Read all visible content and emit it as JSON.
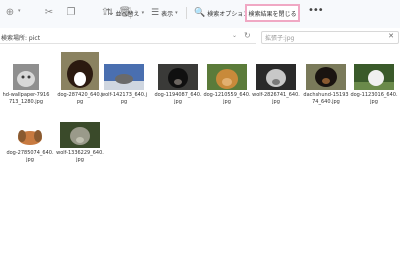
{
  "toolbar": {
    "sort_label": "並べ替え",
    "view_label": "表示",
    "search_options_label": "検索オプション",
    "close_search_label": "検索結果を閉じる",
    "more_label": "•••"
  },
  "address_bar": {
    "text": "検索場所: pict"
  },
  "search_box": {
    "placeholder": "拡張子:jpg"
  },
  "files": [
    {
      "name": "hd-wallpaper-7916713_1280.jpg",
      "thumb_colors": [
        "#8f8f8f",
        "#d8d8d8",
        "#3c3c3c"
      ]
    },
    {
      "name": "dog-287420_640.jpg",
      "thumb_colors": [
        "#8a8260",
        "#ffffff",
        "#2b1a10"
      ]
    },
    {
      "name": "wolf-142173_640.jpg",
      "thumb_colors": [
        "#4a6fb0",
        "#6a6a6a",
        "#cfd6e0"
      ]
    },
    {
      "name": "dog-1194087_640.jpg",
      "thumb_colors": [
        "#3a3a38",
        "#6b6560",
        "#101010"
      ]
    },
    {
      "name": "dog-1210559_640.jpg",
      "thumb_colors": [
        "#5b7b3a",
        "#c88a3a",
        "#e2b070"
      ]
    },
    {
      "name": "wolf-2826741_640.jpg",
      "thumb_colors": [
        "#2a2a2a",
        "#c8c8c8",
        "#7a7a7a"
      ]
    },
    {
      "name": "dachshund-1519374_640.jpg",
      "thumb_colors": [
        "#7a7a5a",
        "#1a1410",
        "#8a5a30"
      ]
    },
    {
      "name": "dog-1123016_640.jpg",
      "thumb_colors": [
        "#3a5a2a",
        "#f0f0f0",
        "#6a8a4a"
      ]
    },
    {
      "name": "dog-2785074_640.jpg",
      "thumb_colors": [
        "#ffffff",
        "#c87a40",
        "#8a5a30"
      ]
    },
    {
      "name": "wolf-1336229_640.jpg",
      "thumb_colors": [
        "#3a4a2a",
        "#9a9a8a",
        "#c0c0b0"
      ]
    }
  ]
}
